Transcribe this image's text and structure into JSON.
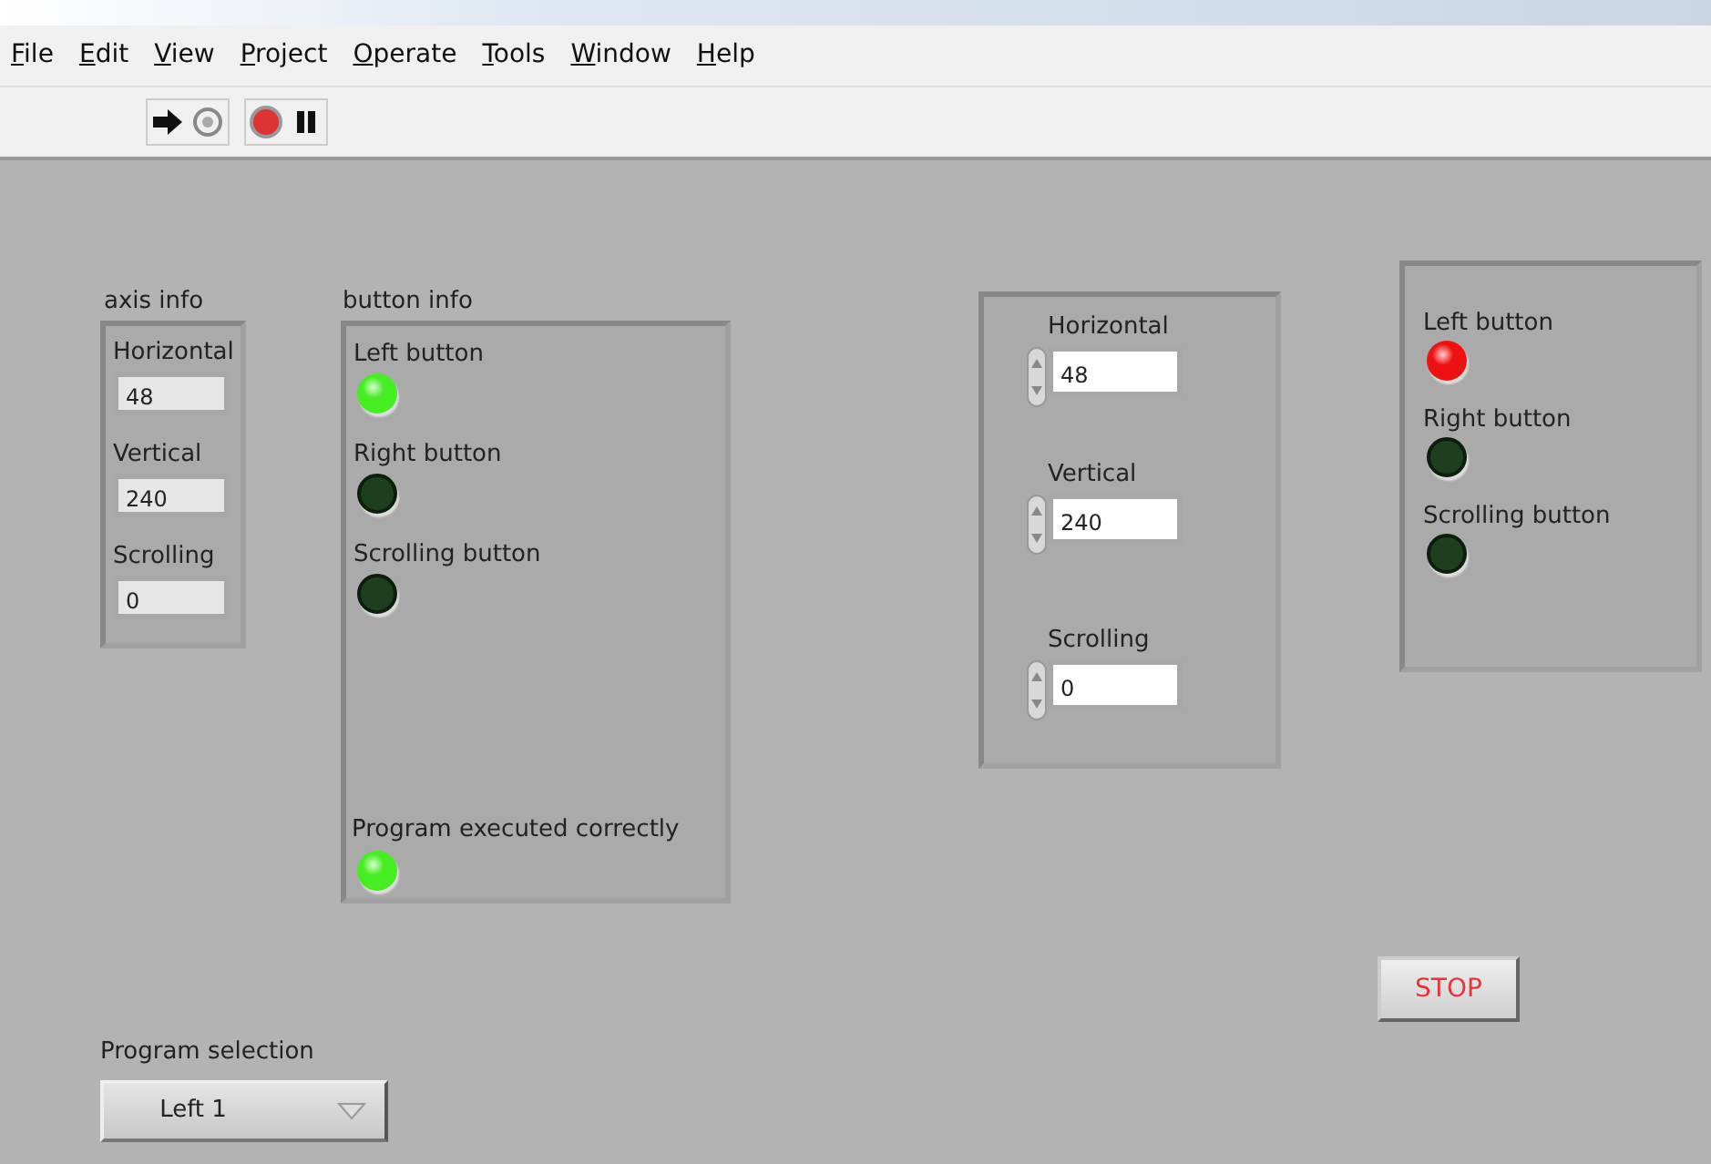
{
  "menu": [
    "File",
    "Edit",
    "View",
    "Project",
    "Operate",
    "Tools",
    "Window",
    "Help"
  ],
  "axis_info": {
    "label": "axis info",
    "fields": [
      {
        "label": "Horizontal",
        "value": "48"
      },
      {
        "label": "Vertical",
        "value": "240"
      },
      {
        "label": "Scrolling",
        "value": "0"
      }
    ]
  },
  "button_info": {
    "label": "button info",
    "leds": [
      {
        "label": "Left button",
        "on": true,
        "color": "#44ee22"
      },
      {
        "label": "Right button",
        "on": false,
        "color": "#1e3f1e"
      },
      {
        "label": "Scrolling button",
        "on": false,
        "color": "#1e3f1e"
      }
    ],
    "status": {
      "label": "Program executed correctly",
      "on": true,
      "color": "#44ee22"
    }
  },
  "controls": {
    "fields": [
      {
        "label": "Horizontal",
        "value": "48"
      },
      {
        "label": "Vertical",
        "value": "240"
      },
      {
        "label": "Scrolling",
        "value": "0"
      }
    ]
  },
  "indicators": {
    "leds": [
      {
        "label": "Left button",
        "on": true,
        "color": "#ee1111"
      },
      {
        "label": "Right button",
        "on": false,
        "color": "#1e3f1e"
      },
      {
        "label": "Scrolling button",
        "on": false,
        "color": "#1e3f1e"
      }
    ]
  },
  "stop_button": {
    "label": "STOP"
  },
  "program_selection": {
    "label": "Program selection",
    "value": "Left 1"
  }
}
